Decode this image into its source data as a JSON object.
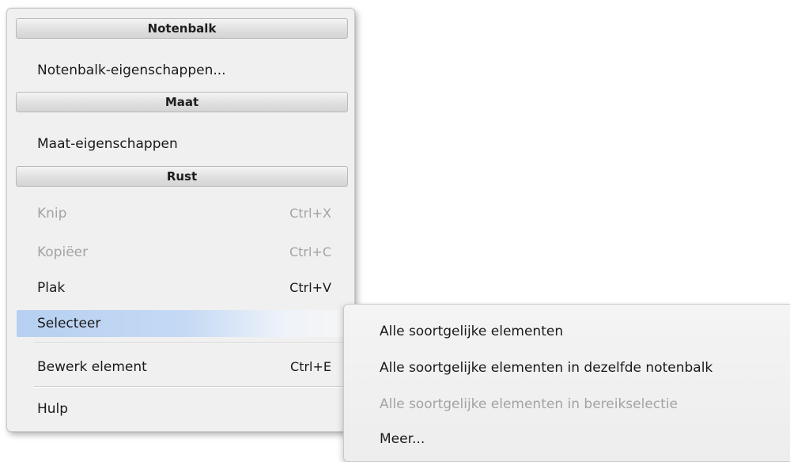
{
  "menu": {
    "sections": [
      {
        "header": "Notenbalk",
        "items": [
          {
            "label": "Notenbalk-eigenschappen..."
          }
        ]
      },
      {
        "header": "Maat",
        "items": [
          {
            "label": "Maat-eigenschappen"
          }
        ]
      },
      {
        "header": "Rust",
        "items": [
          {
            "label": "Knip",
            "shortcut": "Ctrl+X",
            "enabled": false
          },
          {
            "label": "Kopiëer",
            "shortcut": "Ctrl+C",
            "enabled": false
          },
          {
            "label": "Plak",
            "shortcut": "Ctrl+V",
            "enabled": true
          },
          {
            "label": "Selecteer",
            "submenu_arrow": ">",
            "selected": true
          },
          {
            "label": "Bewerk element",
            "shortcut": "Ctrl+E",
            "enabled": true
          },
          {
            "label": "Hulp",
            "enabled": true
          }
        ]
      }
    ]
  },
  "submenu": {
    "items": [
      {
        "label": "Alle soortgelijke elementen",
        "enabled": true
      },
      {
        "label": "Alle soortgelijke elementen in dezelfde notenbalk",
        "enabled": true
      },
      {
        "label": "Alle soortgelijke elementen in bereikselectie",
        "enabled": false
      },
      {
        "label": "Meer...",
        "enabled": true
      }
    ]
  },
  "colors": {
    "menu_background": "#f0f0f0",
    "selected_highlight": "#b7d0f1",
    "disabled_text": "#a3a3a3",
    "text": "#1a1a1a"
  }
}
